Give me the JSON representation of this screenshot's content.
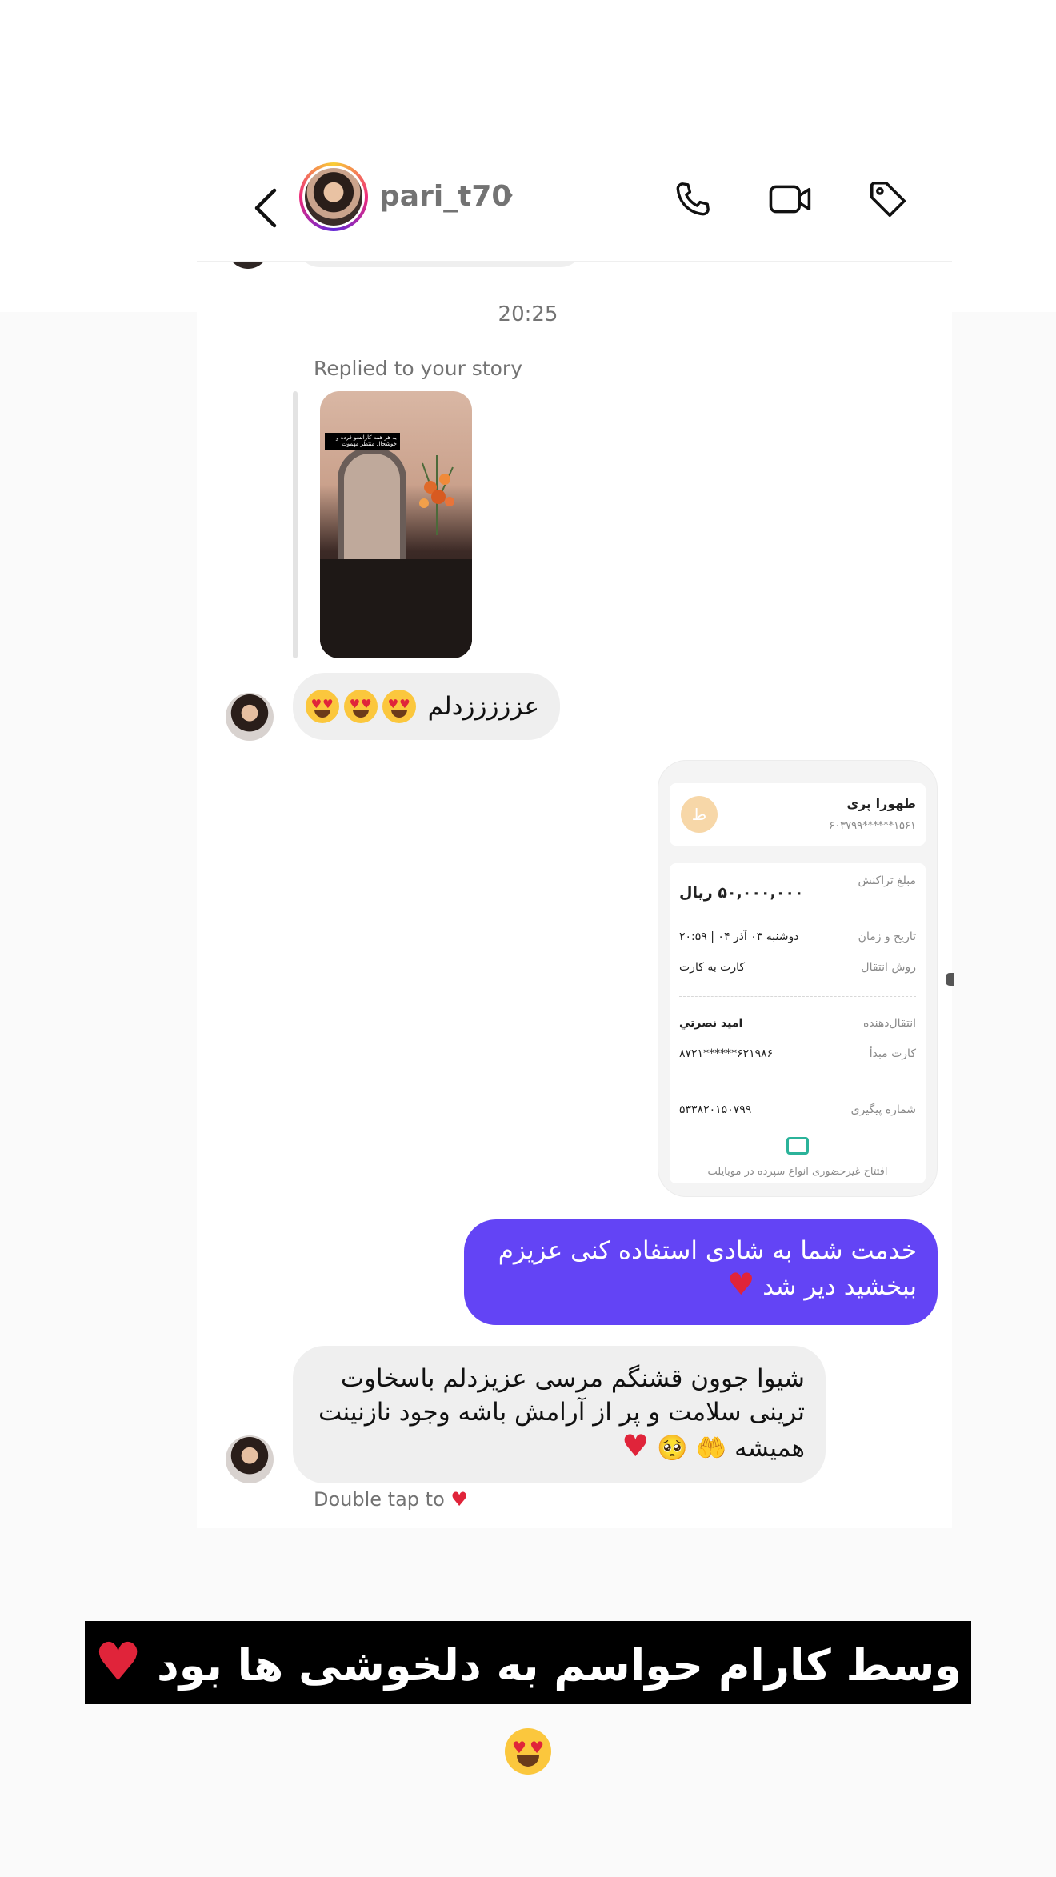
{
  "header": {
    "username": "pari_t70",
    "icons": [
      "back-arrow-icon",
      "chevron-right-icon",
      "phone-icon",
      "video-camera-icon",
      "tag-icon"
    ]
  },
  "thread": {
    "timestamp": "20:25",
    "story_reply_label": "Replied to your story",
    "story_overlay_text": "به هر همه کارانسو قرده و خوشحال منتظر مهموت",
    "msg_emoji_text": "عزززززدلم",
    "msg_thanks_line1": "شیوا جوون قشنگم مرسی عزیزدلم باسخاوت",
    "msg_thanks_line2": "ترینی سلامت و پر از آرامش باشه وجود نازنینت",
    "msg_thanks_line3": "همیشه",
    "sent_line1": "خدمت شما به شادی استفاده کنی عزیزم",
    "sent_line2": "ببخشید دیر شد",
    "heart": "♥",
    "hands_emoji": "🤲",
    "pleading_emoji": "🥺",
    "double_tap_label": "Double tap to",
    "double_tap_heart": "♥"
  },
  "receipt": {
    "recipient_name": "طهورا پری",
    "recipient_account": "۶۰۳۷۹۹******۱۵۶۱",
    "logo_letter": "ط",
    "amount_label": "مبلغ تراکنش",
    "amount_value": "۵۰,۰۰۰,۰۰۰ ریال",
    "datetime_label": "تاریخ و زمان",
    "datetime_value": "دوشنبه ۰۳ آذر ۰۴ | ۲۰:۵۹",
    "method_label": "روش انتقال",
    "method_value": "کارت به کارت",
    "sender_label": "انتقال‌دهنده",
    "sender_value": "امید نصرتي",
    "source_card_label": "کارت مبدأ",
    "source_card_value": "۶۲۱۹۸۶******۸۷۲۱",
    "tracking_label": "شماره پیگیری",
    "tracking_value": "۵۳۳۸۲۰۱۵۰۷۹۹",
    "footer": "افتتاح غیرحضوری انواع سپرده در موبایلت"
  },
  "banner": {
    "text": "وسط کارام  حواسم به دلخوشی ها بود",
    "heart": "♥"
  }
}
